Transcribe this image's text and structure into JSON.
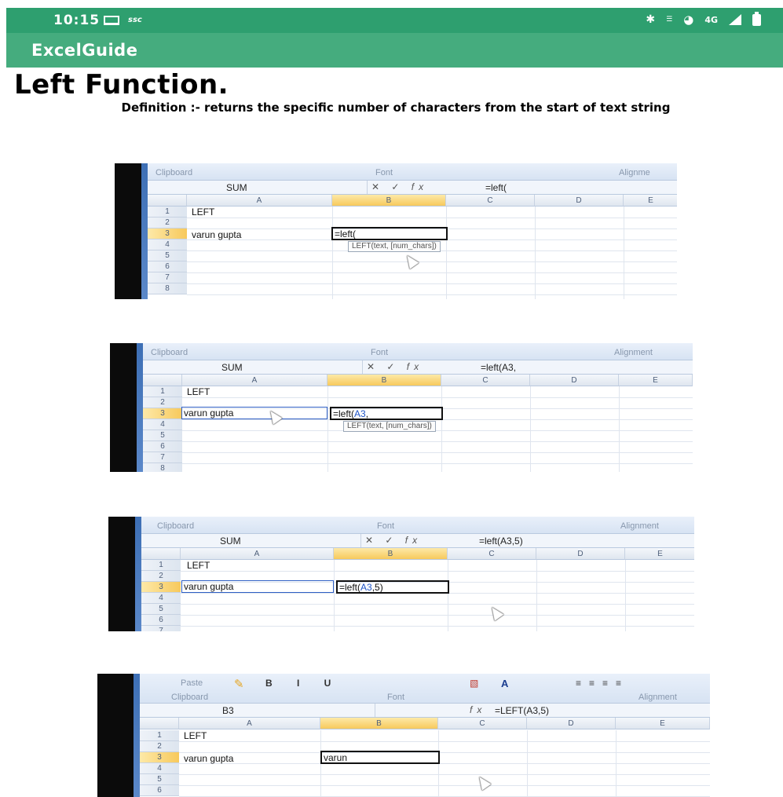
{
  "status_bar": {
    "time": "10:15",
    "carrier_text": "ssc",
    "right_text": "4G"
  },
  "app_bar": {
    "title": "ExcelGuide"
  },
  "content": {
    "heading": "Left Function.",
    "definition": "Definition :- returns the specific number of characters from the start of text string"
  },
  "screenshots": [
    {
      "ribbon": {
        "group1": "Clipboard",
        "group2": "Font",
        "group3": "Alignme"
      },
      "namebox": "SUM",
      "formula": "=left(",
      "columns": [
        "A",
        "B",
        "C",
        "D",
        "E"
      ],
      "rows": [
        "1",
        "2",
        "3",
        "4",
        "5",
        "6",
        "7",
        "8"
      ],
      "a1": "LEFT",
      "a3": "varun gupta",
      "b3_prefix": "=left(",
      "b3_ref": "",
      "b3_suffix": "",
      "tooltip": "LEFT(text, [num_chars])"
    },
    {
      "ribbon": {
        "group1": "Clipboard",
        "group2": "Font",
        "group3": "Alignment"
      },
      "namebox": "SUM",
      "formula": "=left(A3,",
      "columns": [
        "A",
        "B",
        "C",
        "D",
        "E"
      ],
      "rows": [
        "1",
        "2",
        "3",
        "4",
        "5",
        "6",
        "7",
        "8"
      ],
      "a1": "LEFT",
      "a3": "varun gupta",
      "b3_prefix": "=left(",
      "b3_ref": "A3",
      "b3_suffix": ",",
      "tooltip": "LEFT(text, [num_chars])"
    },
    {
      "ribbon": {
        "group1": "Clipboard",
        "group2": "Font",
        "group3": "Alignment"
      },
      "namebox": "SUM",
      "formula": "=left(A3,5)",
      "columns": [
        "A",
        "B",
        "C",
        "D",
        "E"
      ],
      "rows": [
        "1",
        "2",
        "3",
        "4",
        "5",
        "6",
        "7"
      ],
      "a1": "LEFT",
      "a3": "varun gupta",
      "b3_prefix": "=left(",
      "b3_ref": "A3",
      "b3_suffix": ",5)",
      "tooltip": ""
    },
    {
      "ribbon": {
        "group0": "Paste",
        "group1": "Clipboard",
        "group2": "Font",
        "group3": "Alignment"
      },
      "namebox": "B3",
      "formula": "=LEFT(A3,5)",
      "columns": [
        "A",
        "B",
        "C",
        "D",
        "E"
      ],
      "rows": [
        "1",
        "2",
        "3",
        "4",
        "5",
        "6"
      ],
      "a1": "LEFT",
      "a3": "varun gupta",
      "b3_prefix": "varun",
      "b3_ref": "",
      "b3_suffix": "",
      "tooltip": ""
    }
  ]
}
